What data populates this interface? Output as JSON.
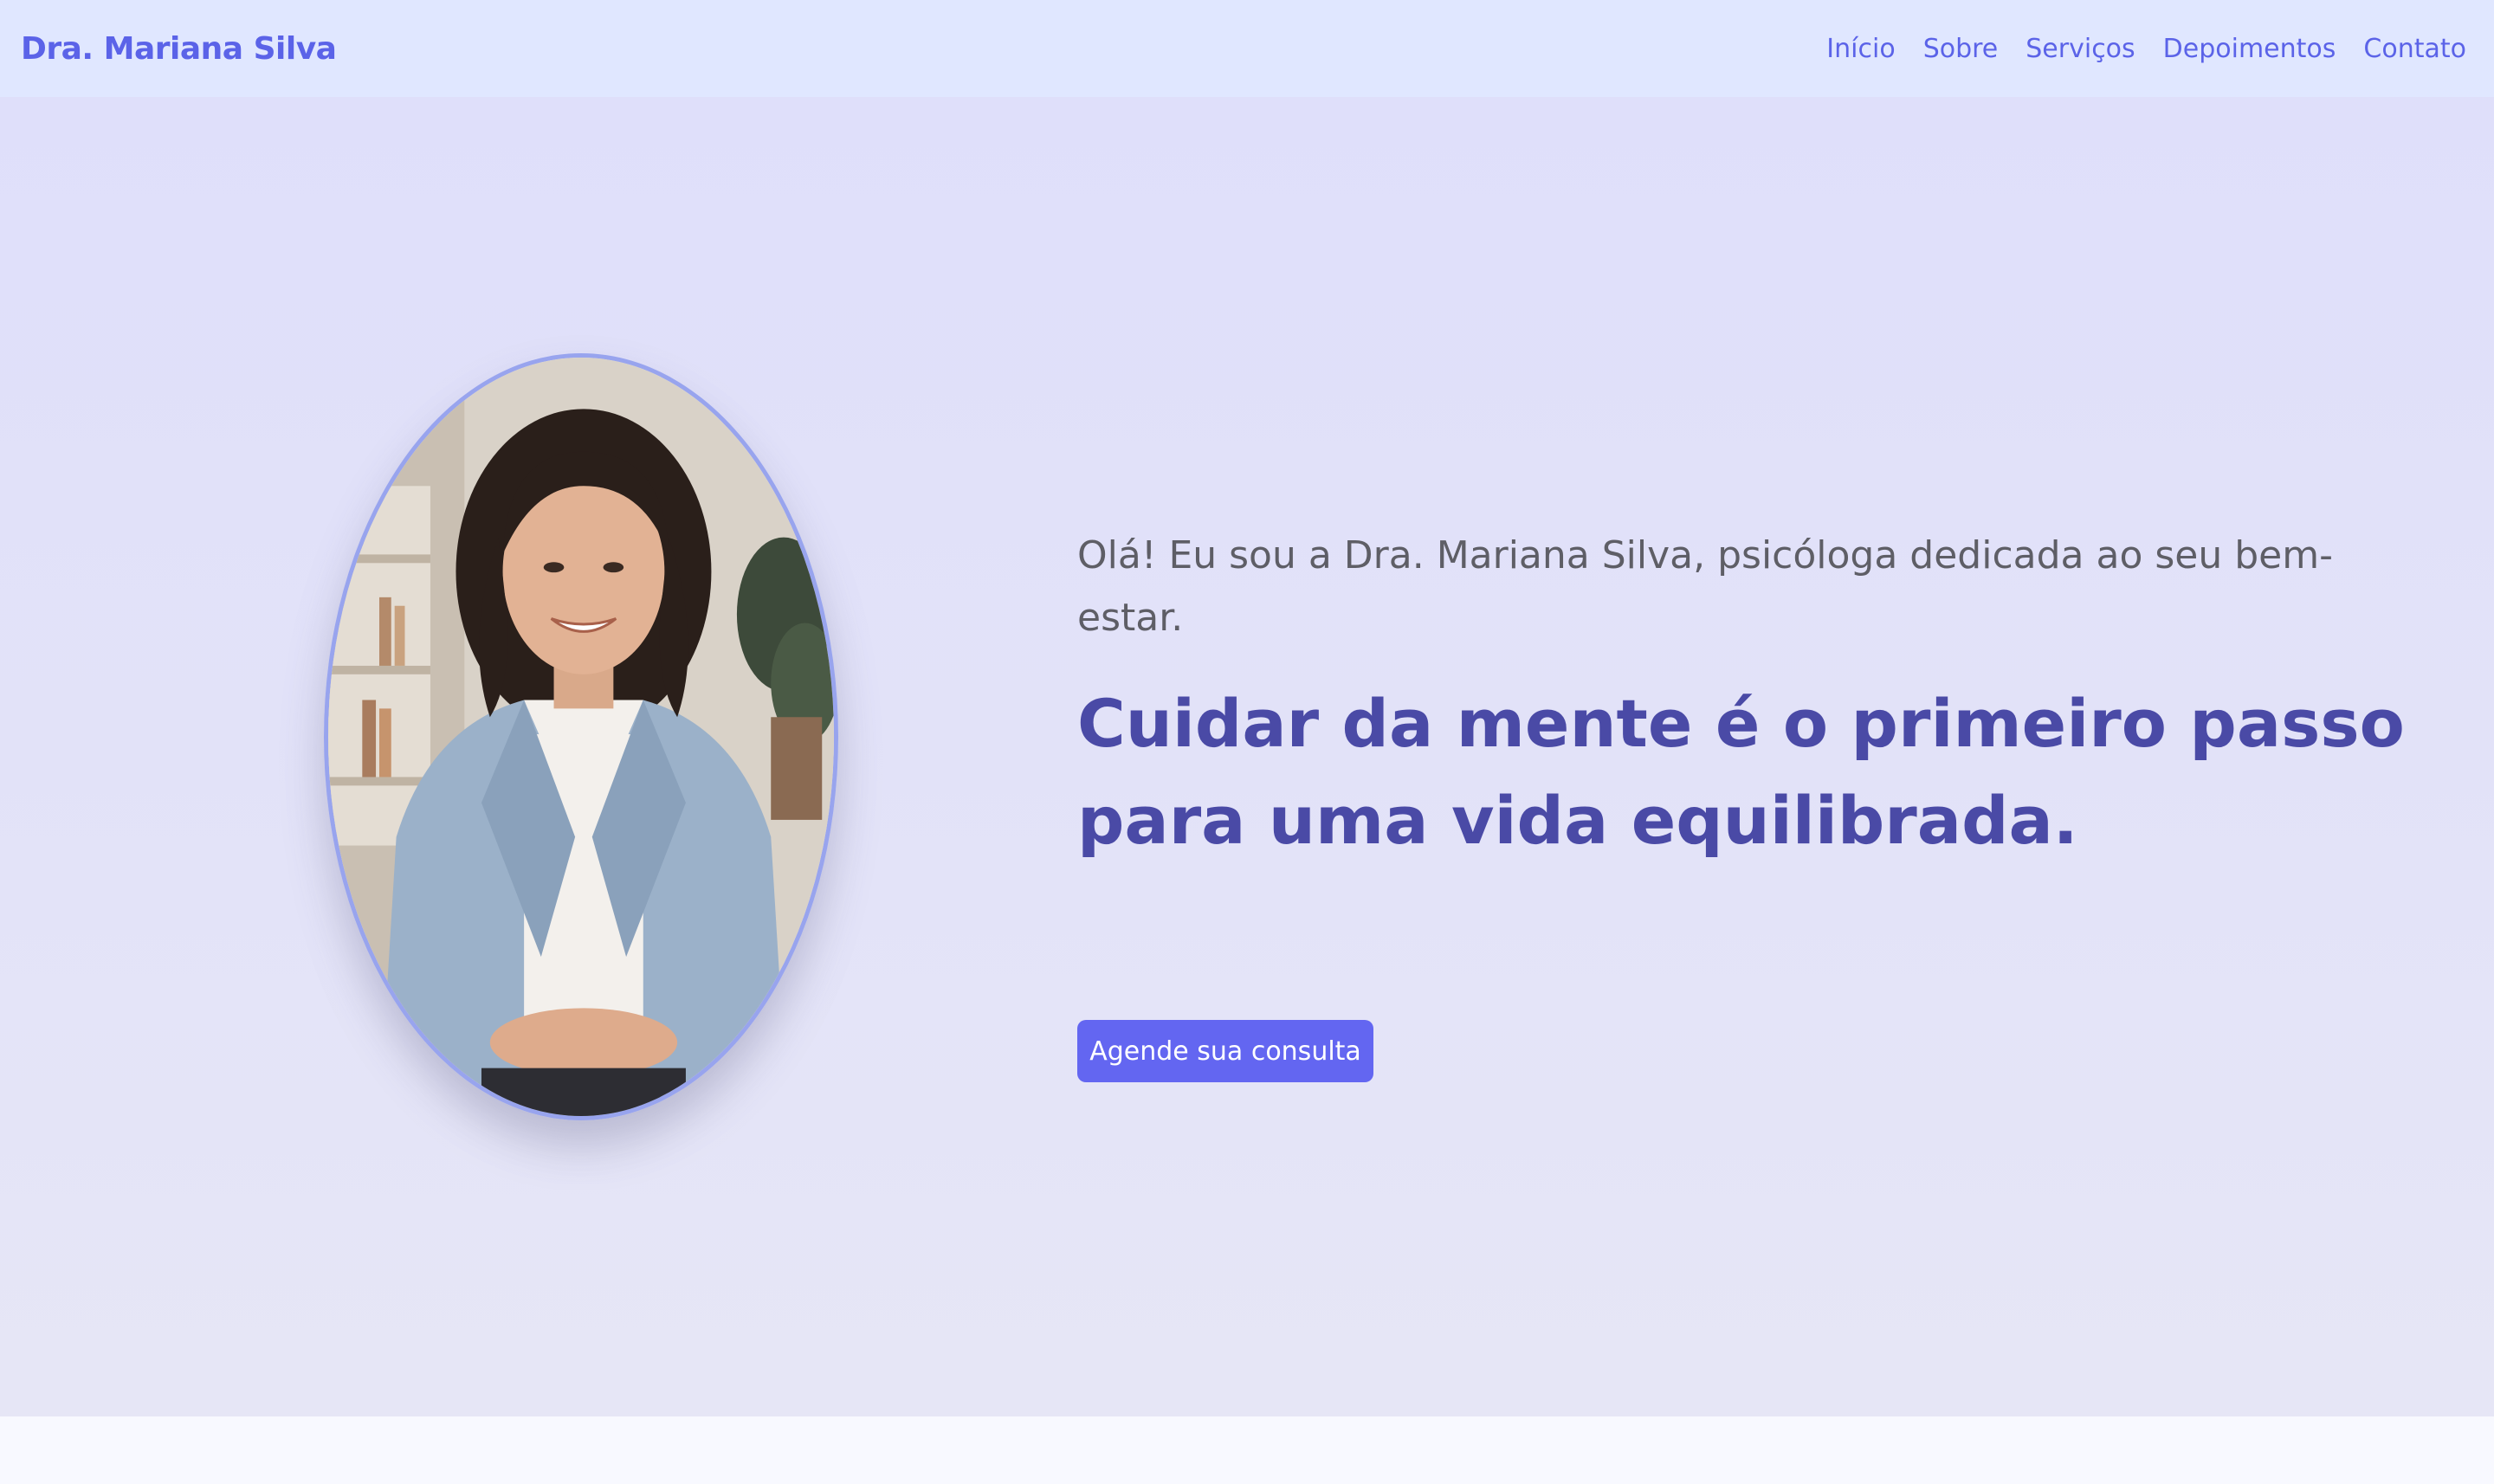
{
  "header": {
    "brand": "Dra. Mariana Silva",
    "nav": [
      {
        "label": "Início"
      },
      {
        "label": "Sobre"
      },
      {
        "label": "Serviços"
      },
      {
        "label": "Depoimentos"
      },
      {
        "label": "Contato"
      }
    ]
  },
  "hero": {
    "intro": "Olá! Eu sou a Dra. Mariana Silva, psicóloga dedicada ao seu bem-estar.",
    "headline": "Cuidar da mente é o primeiro passo para uma vida equilibrada.",
    "cta_label": "Agende sua consulta",
    "portrait_alt": "portrait-photo"
  },
  "colors": {
    "accent": "#6366f1",
    "brand_text": "#5b63e8",
    "nav_bg": "#e0e7ff",
    "hero_bg": "#e0e0fa",
    "headline": "#4a4aa6",
    "body_text": "#5e5e66",
    "portrait_border": "#98a4ee"
  }
}
